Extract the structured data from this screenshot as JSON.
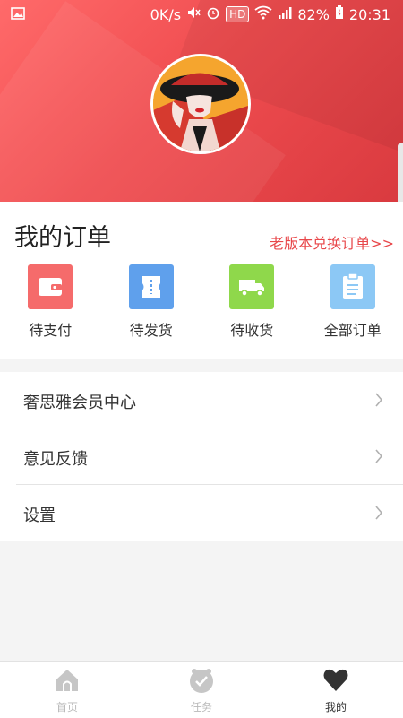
{
  "status_bar": {
    "speed": "0K/s",
    "hd": "HD",
    "battery": "82%",
    "time": "20:31"
  },
  "orders": {
    "title": "我的订单",
    "switch_link": "老版本兑换订单>>",
    "items": [
      {
        "label": "待支付",
        "icon": "wallet-icon",
        "color": "#f56b6b"
      },
      {
        "label": "待发货",
        "icon": "ticket-icon",
        "color": "#5fa0ec"
      },
      {
        "label": "待收货",
        "icon": "truck-icon",
        "color": "#8fd84b"
      },
      {
        "label": "全部订单",
        "icon": "clipboard-icon",
        "color": "#8cc8f5"
      }
    ]
  },
  "menu": {
    "items": [
      {
        "label": "奢思雅会员中心"
      },
      {
        "label": "意见反馈"
      },
      {
        "label": "设置"
      }
    ]
  },
  "tabbar": {
    "tabs": [
      {
        "label": "首页",
        "icon": "home-icon",
        "active": false
      },
      {
        "label": "任务",
        "icon": "task-check-icon",
        "active": false
      },
      {
        "label": "我的",
        "icon": "heart-icon",
        "active": true
      }
    ]
  },
  "colors": {
    "accent": "#e8474a",
    "header": "#f04d50",
    "tab_inactive": "#b9b9b9",
    "tab_active": "#333333"
  }
}
